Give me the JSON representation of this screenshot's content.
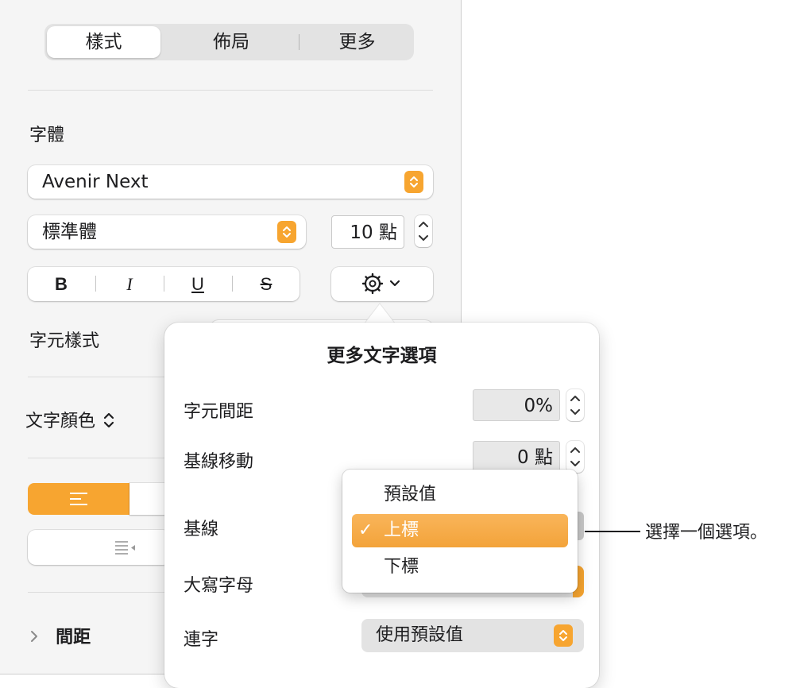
{
  "tabs": [
    {
      "label": "樣式",
      "selected": true
    },
    {
      "label": "佈局",
      "selected": false
    },
    {
      "label": "更多",
      "selected": false
    }
  ],
  "font": {
    "section_label": "字體",
    "family": "Avenir Next",
    "typeface": "標準體",
    "size": "10 點",
    "bold": "B",
    "italic": "I",
    "underline": "U",
    "strikethrough": "S"
  },
  "character_styles_label": "字元樣式",
  "text_color_label": "文字顏色",
  "spacing_label": "間距",
  "popover": {
    "title": "更多文字選項",
    "character_spacing": {
      "label": "字元間距",
      "value": "0%"
    },
    "baseline_shift": {
      "label": "基線移動",
      "value": "0 點"
    },
    "baseline": {
      "label": "基線"
    },
    "capitalization": {
      "label": "大寫字母"
    },
    "ligatures": {
      "label": "連字",
      "value": "使用預設值"
    }
  },
  "baseline_menu": {
    "items": [
      {
        "label": "預設值",
        "selected": false
      },
      {
        "label": "上標",
        "selected": true
      },
      {
        "label": "下標",
        "selected": false
      }
    ],
    "check_mark": "✓"
  },
  "callout": "選擇一個選項。",
  "colors": {
    "accent": "#f7a530",
    "panel_bg": "#f5f5f5"
  }
}
